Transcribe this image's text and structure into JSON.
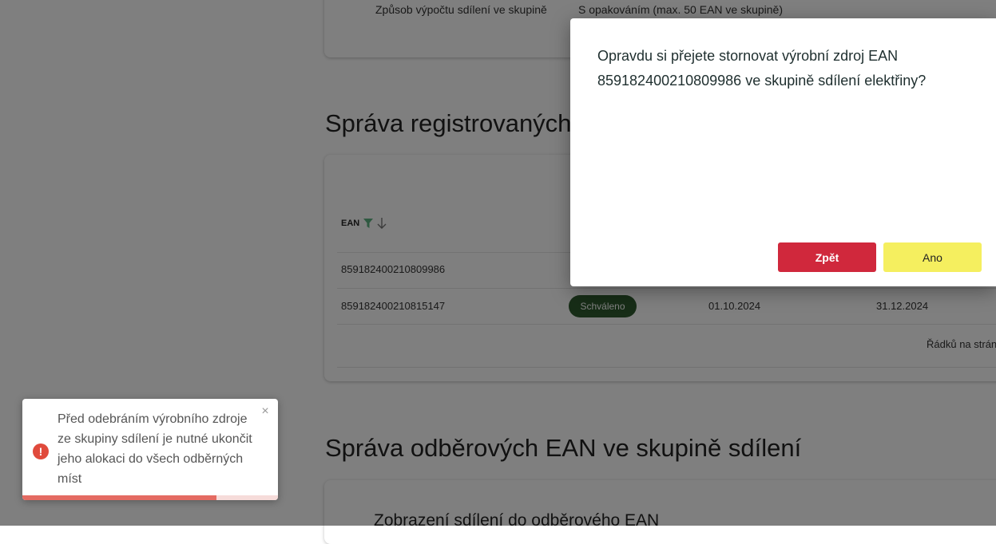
{
  "background": {
    "top_card": {
      "label": "Způsob výpočtu sdílení ve skupině",
      "value": "S opakováním (max. 50 EAN ve skupině)"
    },
    "section_registered_title": "Správa registrovaných výrobních EAN ve skupině sdílení",
    "table": {
      "column_ean": "EAN",
      "rows": [
        {
          "ean": "859182400210809986",
          "status": "",
          "from": "",
          "to": ""
        },
        {
          "ean": "859182400210815147",
          "status": "Schváleno",
          "from": "01.10.2024",
          "to": "31.12.2024"
        }
      ],
      "rows_per_page_label": "Řádků na stránku"
    },
    "section_consumption_title": "Správa odběrových EAN ve skupině sdílení",
    "consumption_subheading": "Zobrazení sdílení do odběrového EAN",
    "colors": {
      "status_approved": "#2e5a2e",
      "filter_icon": "#5fb382"
    }
  },
  "dialog": {
    "message": "Opravdu si přejete stornovat výrobní zdroj EAN 859182400210809986 ve skupině sdílení elektřiny?",
    "back_label": "Zpět",
    "yes_label": "Ano",
    "colors": {
      "back": "#d0283c",
      "yes": "#f5ef5f"
    }
  },
  "toast": {
    "message": "Před odebráním výrobního zdroje ze skupiny sdílení je nutné ukončit jeho alokaci do všech odběrných míst",
    "icon": "error-icon",
    "close_icon": "close-icon",
    "progress": 0.76,
    "colors": {
      "icon": "#e04a3c",
      "progress": "#e46b62"
    }
  }
}
